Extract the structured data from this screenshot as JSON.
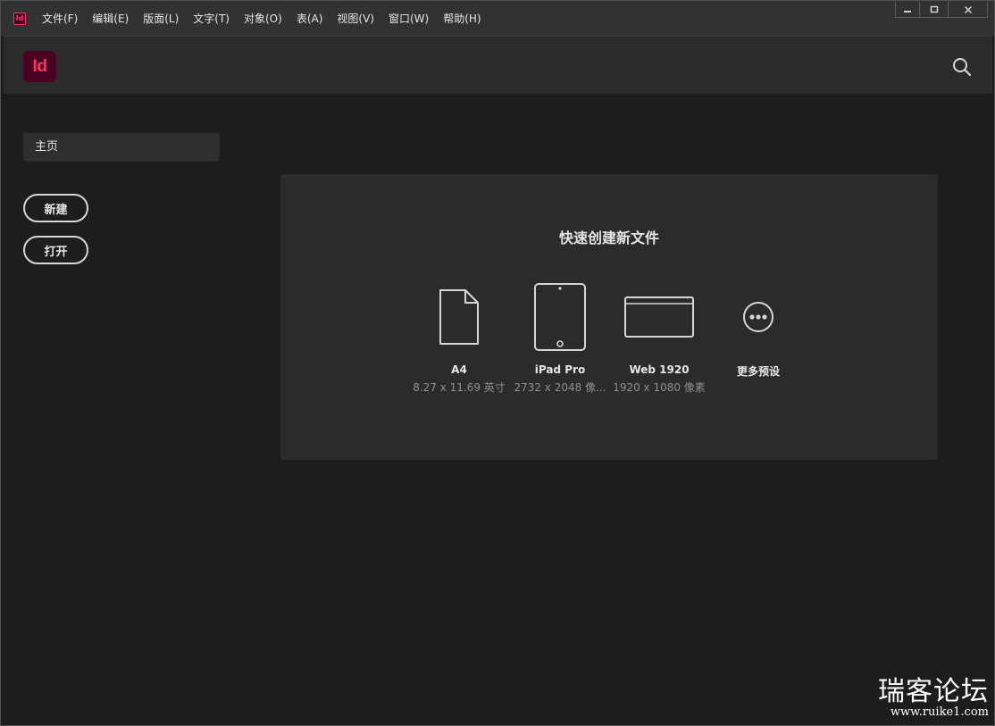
{
  "app": {
    "mini_icon": "Id",
    "logo_text": "Id"
  },
  "menu": [
    "文件(F)",
    "编辑(E)",
    "版面(L)",
    "文字(T)",
    "对象(O)",
    "表(A)",
    "视图(V)",
    "窗口(W)",
    "帮助(H)"
  ],
  "window_controls": {
    "minimize": "minimize-icon",
    "maximize": "maximize-icon",
    "close": "close-icon"
  },
  "header": {
    "search_icon": "search-icon"
  },
  "sidebar": {
    "home_label": "主页",
    "new_label": "新建",
    "open_label": "打开"
  },
  "quick_create": {
    "title": "快速创建新文件",
    "presets": [
      {
        "name": "A4",
        "size": "8.27 x 11.69 英寸",
        "icon": "document-icon"
      },
      {
        "name": "iPad Pro",
        "size": "2732 x 2048 像...",
        "icon": "tablet-icon"
      },
      {
        "name": "Web 1920",
        "size": "1920 x 1080 像素",
        "icon": "browser-window-icon"
      },
      {
        "name": "更多预设",
        "size": "",
        "icon": "more-icon"
      }
    ]
  },
  "watermark": {
    "cn": "瑞客论坛",
    "url": "www.ruike1.com"
  },
  "colors": {
    "brand": "#ff3366",
    "brand_bg": "#49021f",
    "background": "#1d1d1d",
    "panel": "#2b2b2b"
  }
}
